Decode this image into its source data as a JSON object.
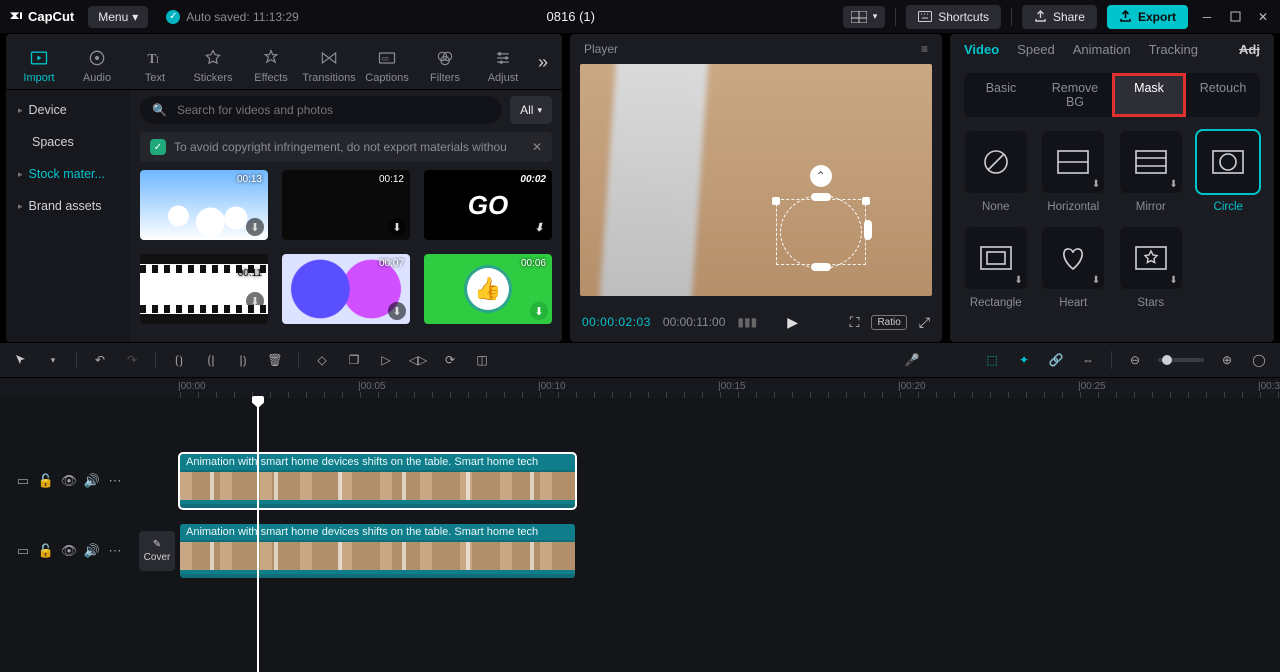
{
  "titlebar": {
    "app_name": "CapCut",
    "menu_label": "Menu",
    "autosave_label": "Auto saved: 11:13:29",
    "project_title": "0816 (1)",
    "shortcuts_label": "Shortcuts",
    "share_label": "Share",
    "export_label": "Export"
  },
  "tool_tabs": [
    {
      "id": "import",
      "label": "Import"
    },
    {
      "id": "audio",
      "label": "Audio"
    },
    {
      "id": "text",
      "label": "Text"
    },
    {
      "id": "stickers",
      "label": "Stickers"
    },
    {
      "id": "effects",
      "label": "Effects"
    },
    {
      "id": "transitions",
      "label": "Transitions"
    },
    {
      "id": "captions",
      "label": "Captions"
    },
    {
      "id": "filters",
      "label": "Filters"
    },
    {
      "id": "adjust",
      "label": "Adjust"
    }
  ],
  "left_sidebar": [
    {
      "id": "device",
      "label": "Device",
      "expandable": true
    },
    {
      "id": "spaces",
      "label": "Spaces",
      "expandable": false
    },
    {
      "id": "stock",
      "label": "Stock mater...",
      "expandable": true,
      "active": true
    },
    {
      "id": "brand",
      "label": "Brand assets",
      "expandable": true
    }
  ],
  "search": {
    "placeholder": "Search for videos and photos",
    "filter_label": "All"
  },
  "warning_text": "To avoid copyright infringement, do not export materials withou",
  "thumbs": [
    {
      "id": "sky",
      "duration": "00:13"
    },
    {
      "id": "dark",
      "duration": "00:12"
    },
    {
      "id": "go",
      "duration": "00:02",
      "text": "GO"
    },
    {
      "id": "film",
      "duration": "00:11"
    },
    {
      "id": "ink",
      "duration": "00:07"
    },
    {
      "id": "like",
      "duration": "00:06",
      "green_dl": true
    }
  ],
  "player": {
    "title": "Player",
    "current_time": "00:00:02:03",
    "total_time": "00:00:11:00",
    "ratio_label": "Ratio"
  },
  "right_tabs": [
    {
      "id": "video",
      "label": "Video",
      "active": true
    },
    {
      "id": "speed",
      "label": "Speed"
    },
    {
      "id": "animation",
      "label": "Animation"
    },
    {
      "id": "tracking",
      "label": "Tracking"
    },
    {
      "id": "adjust",
      "label": "Adj"
    }
  ],
  "right_subtabs": [
    {
      "id": "basic",
      "label": "Basic"
    },
    {
      "id": "removebg",
      "label": "Remove BG"
    },
    {
      "id": "mask",
      "label": "Mask",
      "active": true,
      "highlight": true
    },
    {
      "id": "retouch",
      "label": "Retouch"
    }
  ],
  "masks": [
    {
      "id": "none",
      "label": "None"
    },
    {
      "id": "horizontal",
      "label": "Horizontal"
    },
    {
      "id": "mirror",
      "label": "Mirror"
    },
    {
      "id": "circle",
      "label": "Circle",
      "selected": true
    },
    {
      "id": "rectangle",
      "label": "Rectangle"
    },
    {
      "id": "heart",
      "label": "Heart"
    },
    {
      "id": "stars",
      "label": "Stars"
    }
  ],
  "ruler_labels": [
    "|00:00",
    "|00:05",
    "|00:10",
    "|00:15",
    "|00:20",
    "|00:25",
    "|00:3"
  ],
  "cover_label": "Cover",
  "clip_title": "Animation with smart home devices shifts on the table. Smart home tech"
}
